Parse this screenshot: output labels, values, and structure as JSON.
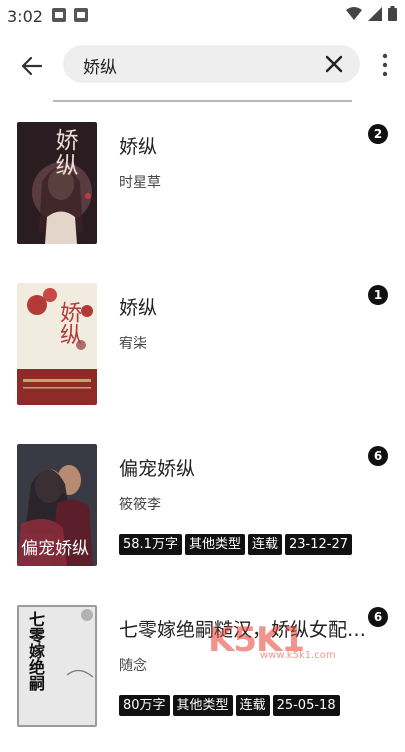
{
  "status_bar": {
    "time": "3:02"
  },
  "search": {
    "query": "娇纵"
  },
  "results": [
    {
      "title": "娇纵",
      "author": "时星草",
      "tags": [],
      "badge": "2",
      "cover_text": "娇纵",
      "cover_bg": "#2a1d22"
    },
    {
      "title": "娇纵",
      "author": "宥柒",
      "tags": [],
      "badge": "1",
      "cover_text": "娇纵",
      "cover_bg": "#f1ebe0"
    },
    {
      "title": "偏宠娇纵",
      "author": "筱筱李",
      "tags": [
        "58.1万字",
        "其他类型",
        "连载",
        "23-12-27"
      ],
      "badge": "6",
      "cover_text": "偏宠娇纵",
      "cover_bg": "#3a3a44"
    },
    {
      "title": "七零嫁绝嗣糙汉，娇纵女配又…",
      "author": "随念",
      "tags": [
        "80万字",
        "其他类型",
        "连载",
        "25-05-18"
      ],
      "badge": "6",
      "cover_text": "七零嫁绝嗣",
      "cover_bg": "#e8e8e8"
    }
  ],
  "watermark": {
    "text": "K5K1",
    "sub": "www.k5k1.com"
  },
  "colors": {
    "tag_bg": "#111111",
    "badge_bg": "#111111",
    "search_bg": "#eeeeee"
  }
}
